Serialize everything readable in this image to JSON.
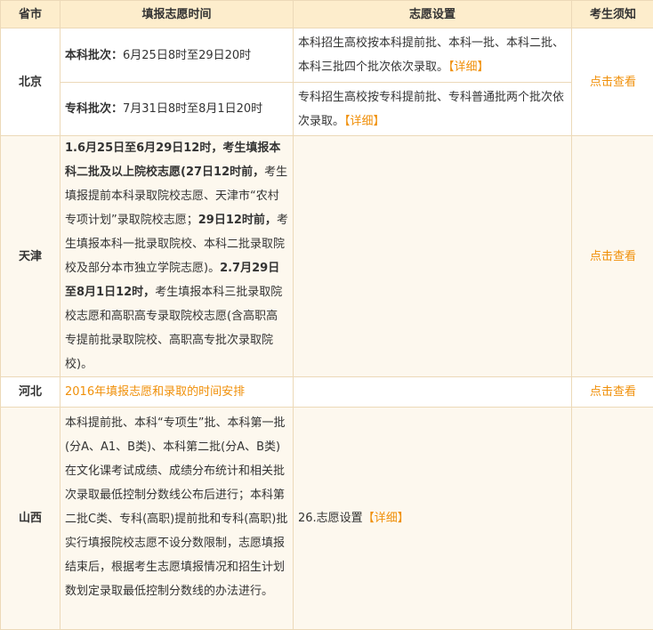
{
  "header": {
    "province": "省市",
    "time": "填报志愿时间",
    "settings": "志愿设置",
    "notice": "考生须知"
  },
  "detail_label": "【详细】",
  "view_label": "点击查看",
  "rows": {
    "beijing": {
      "province": "北京",
      "r1": {
        "label": "本科批次：",
        "time": "6月25日8时至29日20时",
        "settings": "本科招生高校按本科提前批、本科一批、本科二批、本科三批四个批次依次录取。"
      },
      "r2": {
        "label": "专科批次：",
        "time": "7月31日8时至8月1日20时",
        "settings": "专科招生高校按专科提前批、专科普通批两个批次依次录取。"
      }
    },
    "tianjin": {
      "province": "天津",
      "segments": [
        {
          "text": "1.6月25日至6月29日12时，考生填报本科二批及以上院校志愿(27日12时前，",
          "bold": true
        },
        {
          "text": "考生填报提前本科录取院校志愿、天津市“农村专项计划”录取院校志愿；",
          "bold": false
        },
        {
          "text": "29日12时前，",
          "bold": true
        },
        {
          "text": "考生填报本科一批录取院校、本科二批录取院校及部分本市独立学院志愿)。",
          "bold": false
        },
        {
          "text": "2.7月29日至8月1日12时，",
          "bold": true
        },
        {
          "text": "考生填报本科三批录取院校志愿和高职高专录取院校志愿(含高职高专提前批录取院校、高职高专批次录取院校)。",
          "bold": false
        }
      ]
    },
    "hebei": {
      "province": "河北",
      "link": "2016年填报志愿和录取的时间安排"
    },
    "shanxi": {
      "province": "山西",
      "time": "本科提前批、本科“专项生”批、本科第一批(分A、A1、B类)、本科第二批(分A、B类)在文化课考试成绩、成绩分布统计和相关批次录取最低控制分数线公布后进行；本科第二批C类、专科(高职)提前批和专科(高职)批实行填报院校志愿不设分数限制，志愿填报结束后，根据考生志愿填报情况和招生计划数划定录取最低控制分数线的办法进行。",
      "settings": "26.志愿设置"
    }
  },
  "colors": {
    "link": "#f0900a",
    "header_bg": "#fdedcc",
    "border": "#ecd9b8",
    "cream": "#fdf8ee"
  }
}
